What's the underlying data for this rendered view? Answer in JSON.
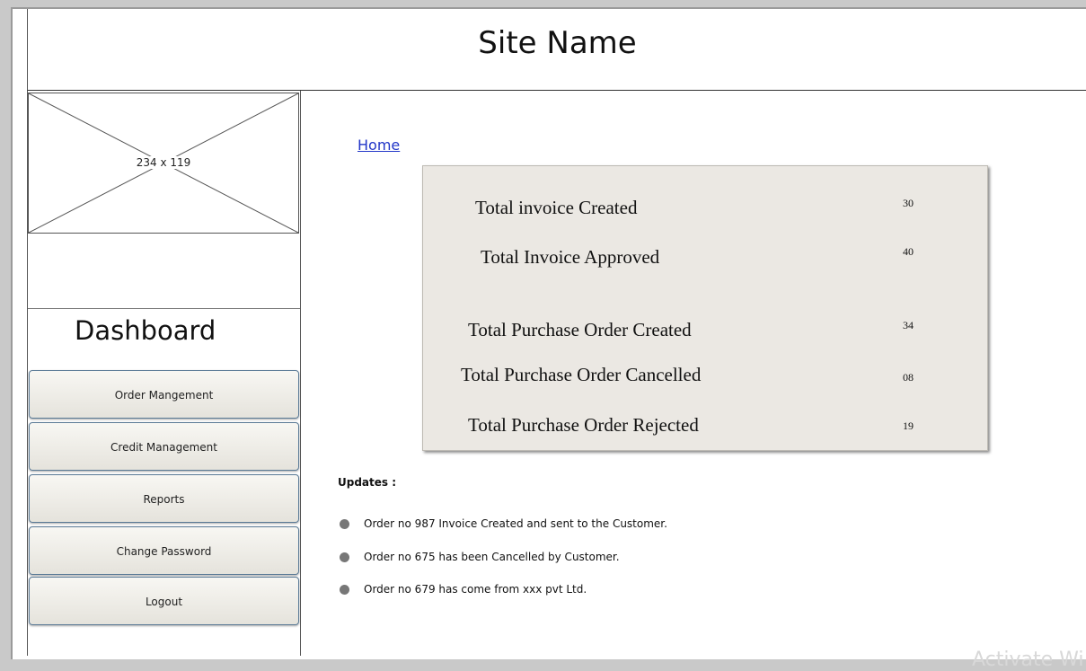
{
  "header": {
    "site_name": "Site Name"
  },
  "sidebar": {
    "logo_placeholder": "234 x 119",
    "dashboard_title": "Dashboard",
    "nav": [
      {
        "label": "Order Mangement"
      },
      {
        "label": "Credit Management"
      },
      {
        "label": "Reports"
      },
      {
        "label": "Change Password"
      },
      {
        "label": "Logout"
      }
    ]
  },
  "breadcrumb": {
    "home": "Home"
  },
  "stats": [
    {
      "label": "Total invoice Created",
      "value": "30"
    },
    {
      "label": "Total Invoice Approved",
      "value": "40"
    },
    {
      "label": "Total Purchase Order Created",
      "value": "34"
    },
    {
      "label": "Total Purchase Order Cancelled",
      "value": "08"
    },
    {
      "label": "Total Purchase Order Rejected",
      "value": "19"
    }
  ],
  "updates": {
    "title": "Updates :",
    "items": [
      "Order no 987 Invoice Created and sent to the Customer.",
      "Order no 675 has been Cancelled by Customer.",
      "Order no 679 has come from xxx pvt Ltd."
    ]
  },
  "watermark": "Activate Wi"
}
